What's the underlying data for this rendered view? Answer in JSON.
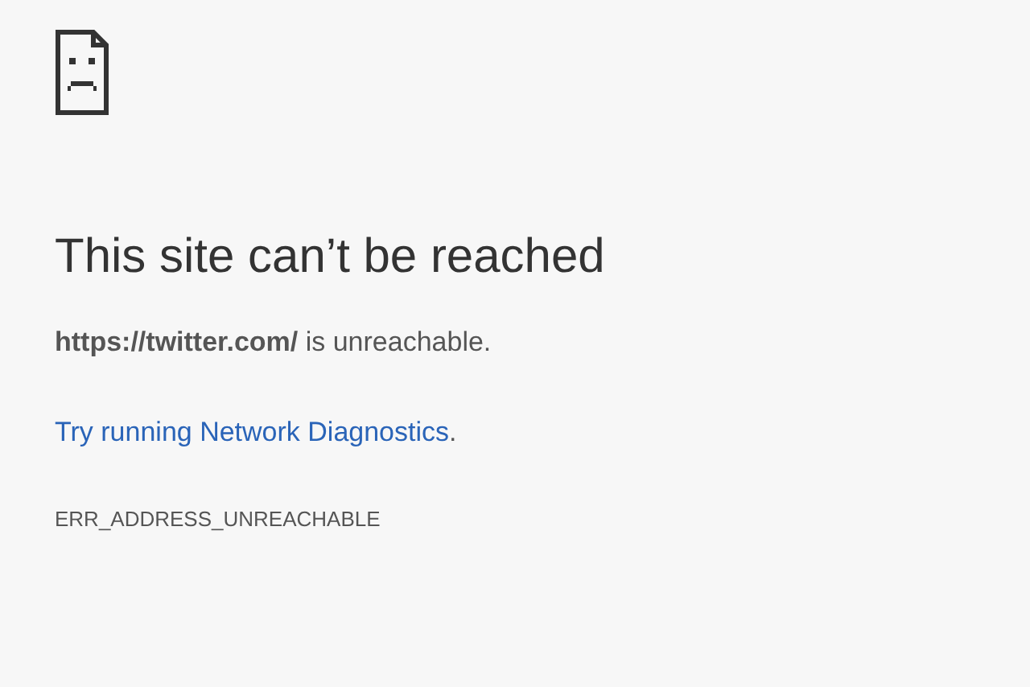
{
  "error_page": {
    "title": "This site can’t be reached",
    "message": "**https://twitter.com/** is unreachable.",
    "suggestion": {
      "link": "Try running Network Diagnostics",
      "after": "."
    },
    "error_code": "ERR_ADDRESS_UNREACHABLE"
  }
}
